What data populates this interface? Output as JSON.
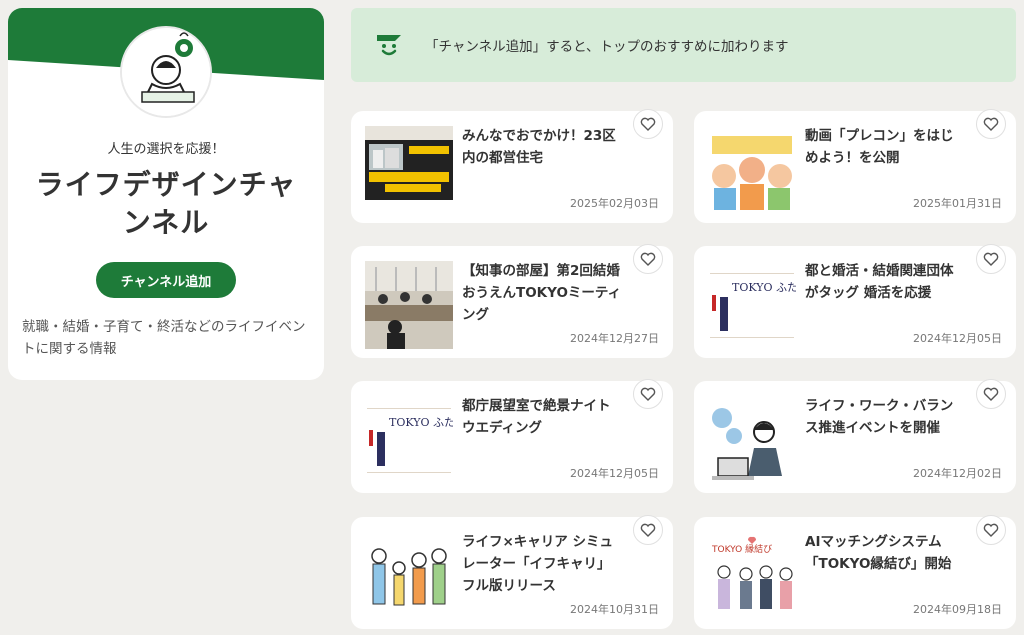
{
  "channel": {
    "tagline": "人生の選択を応援！",
    "name": "ライフデザインチャンネル",
    "add_button_label": "チャンネル追加",
    "description": "就職・結婚・子育て・終活などのライフイベントに関する情報",
    "banner_color": "#1e7b39"
  },
  "notice": {
    "text": "「チャンネル追加」すると、トップのおすすめに加わります",
    "background": "#d7ecd9"
  },
  "articles": [
    {
      "title": "みんなでおでかけ！23区内の都営住宅",
      "date": "2025年02月03日",
      "thumb": "video-thumb-icon"
    },
    {
      "title": "動画「プレコン」をはじめよう！を公開",
      "date": "2025年01月31日",
      "thumb": "illustration-icon"
    },
    {
      "title": "【知事の部屋】第2回結婚おうえんTOKYOミーティング",
      "date": "2024年12月27日",
      "thumb": "meeting-photo-icon"
    },
    {
      "title": "都と婚活・結婚関連団体がタッグ 婚活を応援",
      "date": "2024年12月05日",
      "thumb": "tokyo-futari-story-logo",
      "logo_text": "TOKYO ふたり STORY"
    },
    {
      "title": "都庁展望室で絶景ナイトウエディング",
      "date": "2024年12月05日",
      "thumb": "tokyo-futari-story-logo",
      "logo_text": "TOKYO ふたり STORY"
    },
    {
      "title": "ライフ・ワーク・バランス推進イベントを開催",
      "date": "2024年12月02日",
      "thumb": "laptop-person-icon"
    },
    {
      "title": "ライフ×キャリア シミュレーター「イフキャリ」フル版リリース",
      "date": "2024年10月31日",
      "thumb": "family-illustration-icon"
    },
    {
      "title": "AIマッチングシステム「TOKYO縁結び」開始",
      "date": "2024年09月18日",
      "thumb": "tokyo-enmusubi-icon",
      "logo_text": "TOKYO 縁結び"
    }
  ],
  "icons": {
    "favorite": "heart-icon",
    "notice": "smile-channel-icon"
  }
}
